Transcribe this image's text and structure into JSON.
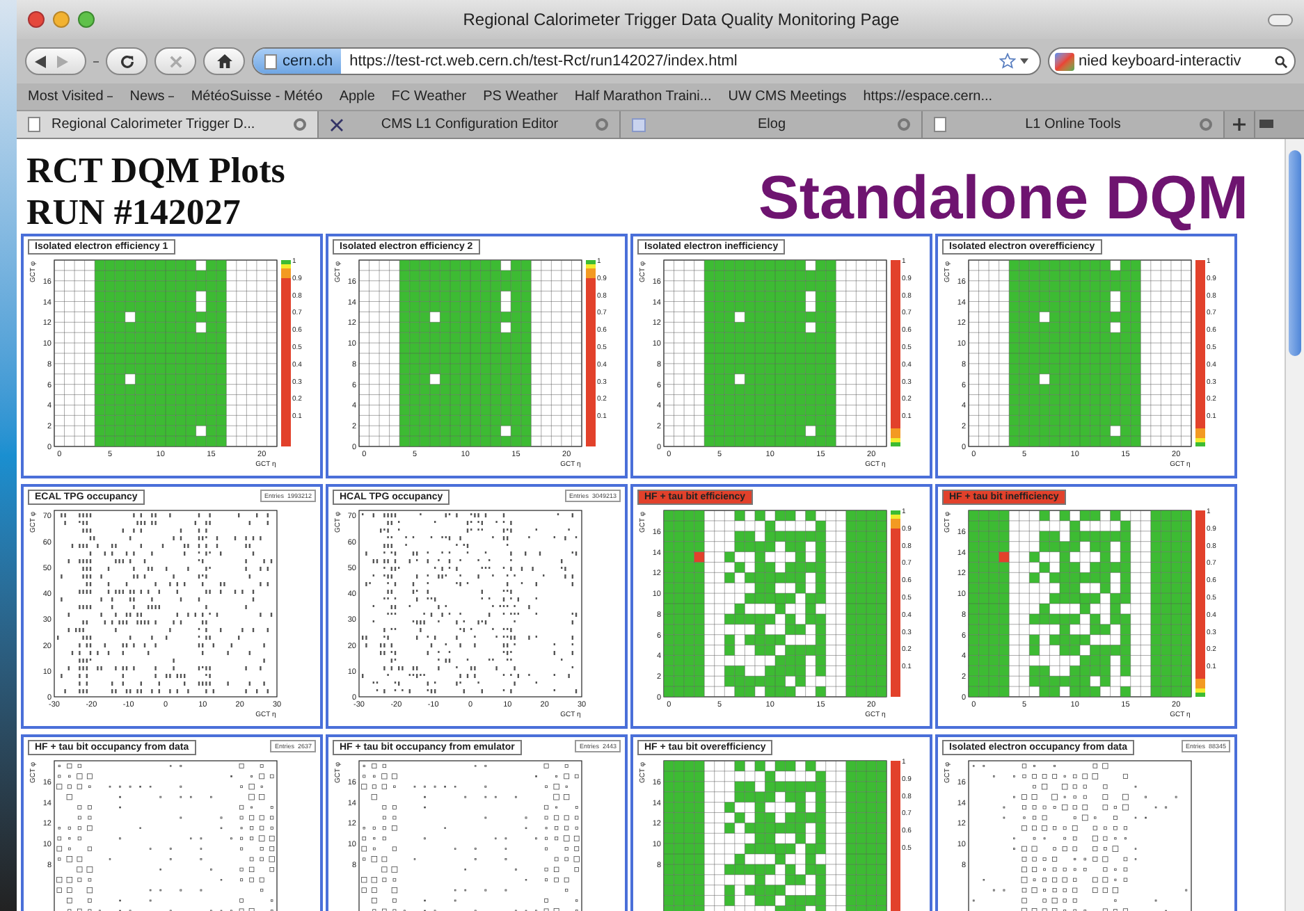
{
  "window": {
    "title": "Regional Calorimeter Trigger Data Quality Monitoring Page"
  },
  "toolbar": {
    "site": "cern.ch",
    "url": "https://test-rct.web.cern.ch/test-Rct/run142027/index.html",
    "search": "nied keyboard-interactiv"
  },
  "bookmarks": [
    {
      "label": "Most Visited",
      "menu": true
    },
    {
      "label": "News",
      "menu": true
    },
    {
      "label": "MétéoSuisse - Météo",
      "menu": false
    },
    {
      "label": "Apple",
      "menu": false
    },
    {
      "label": "FC Weather",
      "menu": false
    },
    {
      "label": "PS Weather",
      "menu": false
    },
    {
      "label": "Half Marathon Traini...",
      "menu": false
    },
    {
      "label": "UW CMS Meetings",
      "menu": false
    },
    {
      "label": "https://espace.cern...",
      "menu": false
    }
  ],
  "tabs": [
    {
      "label": "Regional Calorimeter Trigger D...",
      "selected": true,
      "kind": "page"
    },
    {
      "label": "CMS L1 Configuration Editor",
      "selected": false,
      "kind": "tool"
    },
    {
      "label": "Elog",
      "selected": false,
      "kind": "grid"
    },
    {
      "label": "L1 Online Tools",
      "selected": false,
      "kind": "page"
    }
  ],
  "page": {
    "heading": [
      "RCT DQM Plots",
      "RUN #142027"
    ],
    "banner": "Standalone DQM"
  },
  "plots": [
    {
      "title": "Isolated electron efficiency 1",
      "kind": "efficiency",
      "alert": false,
      "green_on_top": true,
      "ylabel": "GCT φ",
      "xlabel": "GCT η",
      "yticks": [
        "16",
        "14",
        "12",
        "10",
        "8",
        "6",
        "4",
        "2",
        "0"
      ],
      "xticks": [
        "0",
        "5",
        "10",
        "15",
        "20"
      ],
      "zticks": [
        "1",
        "0.9",
        "0.8",
        "0.7",
        "0.6",
        "0.5",
        "0.4",
        "0.3",
        "0.2",
        "0.1"
      ]
    },
    {
      "title": "Isolated electron efficiency 2",
      "kind": "efficiency",
      "alert": false,
      "green_on_top": true,
      "ylabel": "GCT φ",
      "xlabel": "GCT η",
      "yticks": [
        "16",
        "14",
        "12",
        "10",
        "8",
        "6",
        "4",
        "2",
        "0"
      ],
      "xticks": [
        "0",
        "5",
        "10",
        "15",
        "20"
      ],
      "zticks": [
        "1",
        "0.9",
        "0.8",
        "0.7",
        "0.6",
        "0.5",
        "0.4",
        "0.3",
        "0.2",
        "0.1"
      ]
    },
    {
      "title": "Isolated electron inefficiency",
      "kind": "efficiency",
      "alert": false,
      "green_on_top": false,
      "ylabel": "GCT φ",
      "xlabel": "GCT η",
      "yticks": [
        "16",
        "14",
        "12",
        "10",
        "8",
        "6",
        "4",
        "2",
        "0"
      ],
      "xticks": [
        "0",
        "5",
        "10",
        "15",
        "20"
      ],
      "zticks": [
        "1",
        "0.9",
        "0.8",
        "0.7",
        "0.6",
        "0.5",
        "0.4",
        "0.3",
        "0.2",
        "0.1"
      ]
    },
    {
      "title": "Isolated electron overefficiency",
      "kind": "efficiency",
      "alert": false,
      "green_on_top": false,
      "ylabel": "GCT φ",
      "xlabel": "GCT η",
      "yticks": [
        "16",
        "14",
        "12",
        "10",
        "8",
        "6",
        "4",
        "2",
        "0"
      ],
      "xticks": [
        "0",
        "5",
        "10",
        "15",
        "20"
      ],
      "zticks": [
        "1",
        "0.9",
        "0.8",
        "0.7",
        "0.6",
        "0.5",
        "0.4",
        "0.3",
        "0.2",
        "0.1"
      ]
    },
    {
      "title": "ECAL TPG occupancy",
      "kind": "density",
      "alert": false,
      "entries": "Entries  1993212",
      "ylabel": "GCT φ",
      "xlabel": "GCT η",
      "yticks": [
        "70",
        "60",
        "50",
        "40",
        "30",
        "20",
        "10",
        "0"
      ],
      "xticks": [
        "-30",
        "-20",
        "-10",
        "0",
        "10",
        "20",
        "30"
      ]
    },
    {
      "title": "HCAL TPG occupancy",
      "kind": "density",
      "alert": false,
      "entries": "Entries  3049213",
      "ylabel": "GCT φ",
      "xlabel": "GCT η",
      "yticks": [
        "70",
        "60",
        "50",
        "40",
        "30",
        "20",
        "10",
        "0"
      ],
      "xticks": [
        "-30",
        "-20",
        "-10",
        "0",
        "10",
        "20",
        "30"
      ]
    },
    {
      "title": "HF + tau bit efficiency",
      "kind": "hf",
      "alert": true,
      "green_on_top": true,
      "ylabel": "GCT φ",
      "xlabel": "GCT η",
      "yticks": [
        "16",
        "14",
        "12",
        "10",
        "8",
        "6",
        "4",
        "2",
        "0"
      ],
      "xticks": [
        "0",
        "5",
        "10",
        "15",
        "20"
      ],
      "zticks": [
        "1",
        "0.9",
        "0.8",
        "0.7",
        "0.6",
        "0.5",
        "0.4",
        "0.3",
        "0.2",
        "0.1"
      ]
    },
    {
      "title": "HF + tau bit inefficiency",
      "kind": "hf",
      "alert": true,
      "green_on_top": false,
      "ylabel": "GCT φ",
      "xlabel": "GCT η",
      "yticks": [
        "16",
        "14",
        "12",
        "10",
        "8",
        "6",
        "4",
        "2",
        "0"
      ],
      "xticks": [
        "0",
        "5",
        "10",
        "15",
        "20"
      ],
      "zticks": [
        "1",
        "0.9",
        "0.8",
        "0.7",
        "0.6",
        "0.5",
        "0.4",
        "0.3",
        "0.2",
        "0.1"
      ]
    },
    {
      "title": "HF + tau bit occupancy from data",
      "kind": "occupancy",
      "alert": false,
      "entries": "Entries  2637",
      "ylabel": "GCT φ",
      "yticks": [
        "16",
        "14",
        "12",
        "10",
        "8"
      ]
    },
    {
      "title": "HF + tau bit occupancy from emulator",
      "kind": "occupancy",
      "alert": false,
      "entries": "Entries  2443",
      "ylabel": "GCT φ",
      "yticks": [
        "16",
        "14",
        "12",
        "10",
        "8"
      ]
    },
    {
      "title": "HF + tau bit overefficiency",
      "kind": "hf",
      "alert": false,
      "green_on_top": false,
      "ylabel": "GCT φ",
      "yticks": [
        "16",
        "14",
        "12",
        "10",
        "8"
      ],
      "zticks": [
        "1",
        "0.9",
        "0.8",
        "0.7",
        "0.6",
        "0.5"
      ]
    },
    {
      "title": "Isolated electron occupancy from data",
      "kind": "occupancy",
      "alert": false,
      "entries": "Entries  88345",
      "ylabel": "GCT φ",
      "yticks": [
        "16",
        "14",
        "12",
        "10",
        "8"
      ]
    }
  ]
}
